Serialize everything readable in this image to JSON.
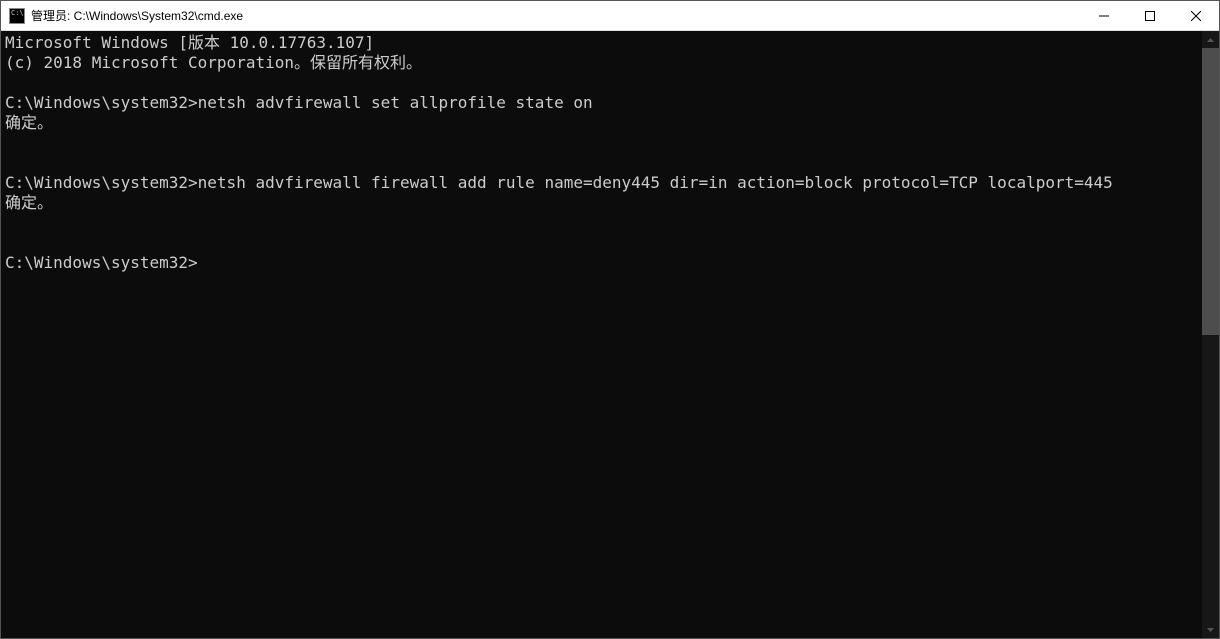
{
  "window": {
    "title": "管理员: C:\\Windows\\System32\\cmd.exe"
  },
  "console": {
    "line1": "Microsoft Windows [版本 10.0.17763.107]",
    "line2": "(c) 2018 Microsoft Corporation。保留所有权利。",
    "blank1": "",
    "prompt1": "C:\\Windows\\system32>",
    "cmd1": "netsh advfirewall set allprofile state on",
    "result1": "确定。",
    "blank2": "",
    "blank3": "",
    "prompt2": "C:\\Windows\\system32>",
    "cmd2": "netsh advfirewall firewall add rule name=deny445 dir=in action=block protocol=TCP localport=445",
    "result2": "确定。",
    "blank4": "",
    "blank5": "",
    "prompt3": "C:\\Windows\\system32>"
  }
}
